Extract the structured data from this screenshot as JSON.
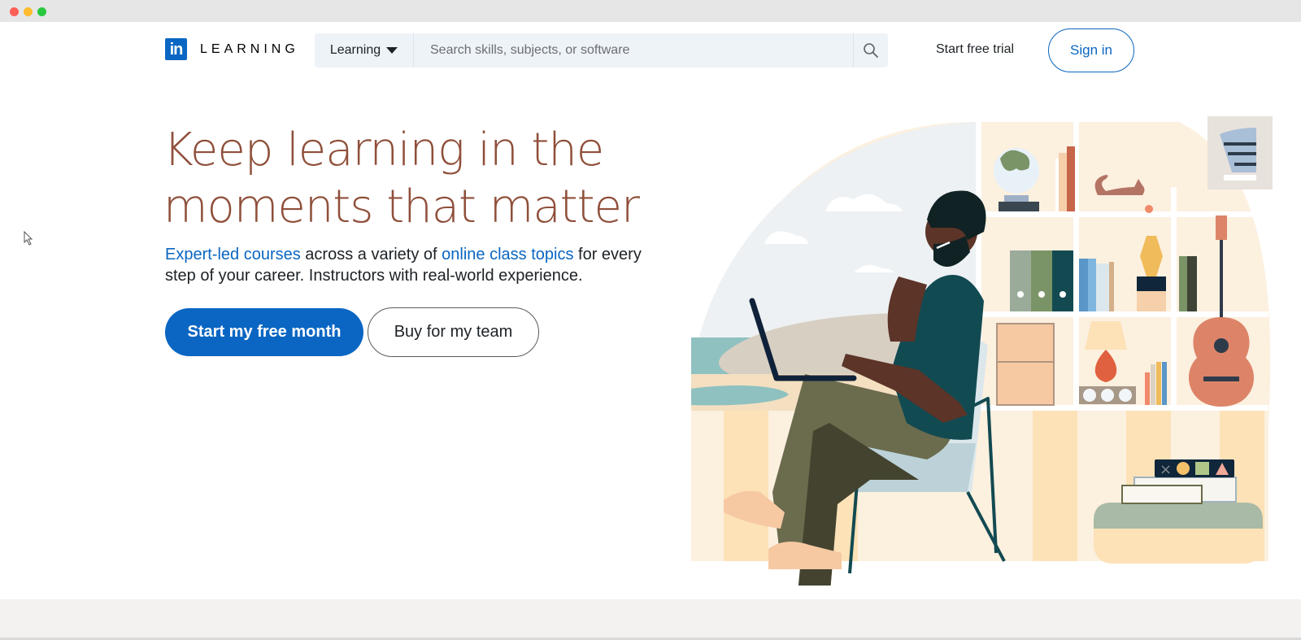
{
  "window": {
    "controls": [
      "close",
      "minimize",
      "maximize"
    ]
  },
  "header": {
    "logo_mark": "in",
    "logo_word": "LEARNING",
    "search": {
      "scope_label": "Learning",
      "placeholder": "Search skills, subjects, or software",
      "value": "",
      "icon": "search-icon"
    },
    "start_trial_label": "Start free trial",
    "sign_in_label": "Sign in"
  },
  "hero": {
    "title": "Keep learning in the moments that matter",
    "subtitle": {
      "link1": "Expert-led courses",
      "text1": " across a variety of ",
      "link2": "online class topics",
      "text2": " for every step of your career. Instructors with real-world experience."
    },
    "primary_cta": "Start my free month",
    "secondary_cta": "Buy for my team"
  },
  "illustration": {
    "description": "Person with glasses and beard sitting in chair using a laptop in front of shelves with globe, cat, binders, lamp and guitar"
  },
  "colors": {
    "brand_blue": "#0a66c2",
    "headline": "#8f4f3a",
    "search_bg": "#eef3f8"
  }
}
